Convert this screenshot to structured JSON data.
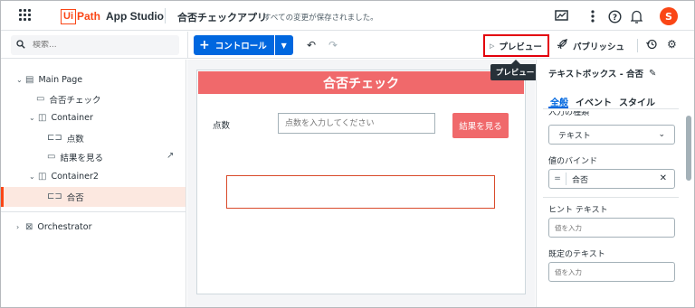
{
  "header": {
    "logo_ui": "Ui",
    "logo_path": "Path",
    "logo_product": "App Studio",
    "app_name": "合否チェックアプリ",
    "save_status": "すべての変更が保存されました。",
    "avatar_initial": "S"
  },
  "toolbar": {
    "search_placeholder": "検索...",
    "control_label": "コントロール",
    "preview_label": "プレビュー",
    "publish_label": "パブリッシュ",
    "tooltip": "プレビュー"
  },
  "tree": {
    "items": [
      {
        "label": "Main Page"
      },
      {
        "label": "合否チェック"
      },
      {
        "label": "Container"
      },
      {
        "label": "点数"
      },
      {
        "label": "結果を見る"
      },
      {
        "label": "Container2"
      },
      {
        "label": "合否"
      },
      {
        "label": "Orchestrator"
      }
    ]
  },
  "canvas": {
    "title": "合否チェック",
    "score_label": "点数",
    "score_placeholder": "点数を入力してください",
    "result_button": "結果を見る"
  },
  "props": {
    "title": "テキストボックス - 合否",
    "tabs": [
      "全般",
      "イベント",
      "スタイル"
    ],
    "cut_label": "入力の種類",
    "input_type_value": "テキスト",
    "bind_label": "値のバインド",
    "bind_eq": "=",
    "bind_value": "合否",
    "hint_label": "ヒント テキスト",
    "hint_placeholder": "値を入力",
    "default_label": "既定のテキスト",
    "default_placeholder": "値を入力"
  },
  "colors": {
    "brand": "#fa4616",
    "primary": "#0067df",
    "header_red": "#f0696b",
    "highlight_border": "#e3000b"
  }
}
